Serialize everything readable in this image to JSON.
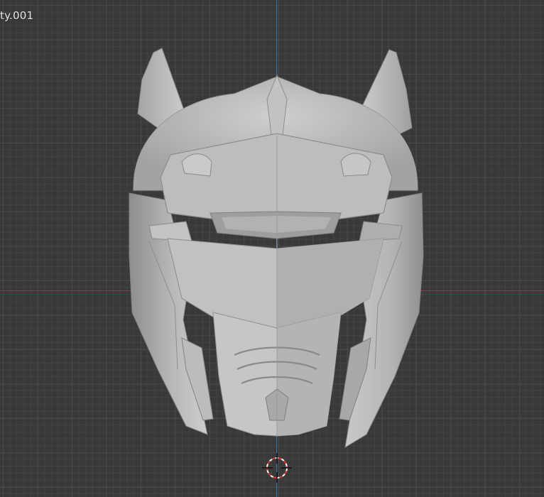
{
  "viewport": {
    "object_label": "ty.001",
    "background_color": "#393939",
    "grid_color": "#474747",
    "x_axis_color": "#8b3a45",
    "z_axis_color": "#3d6fa8"
  },
  "mesh": {
    "name": "helmet-mesh",
    "surface_light": "#d2d2d2",
    "surface_mid": "#b3b3b3",
    "surface_dark": "#8c8c8c"
  },
  "cursor": {
    "icon": "3d-cursor-icon"
  }
}
